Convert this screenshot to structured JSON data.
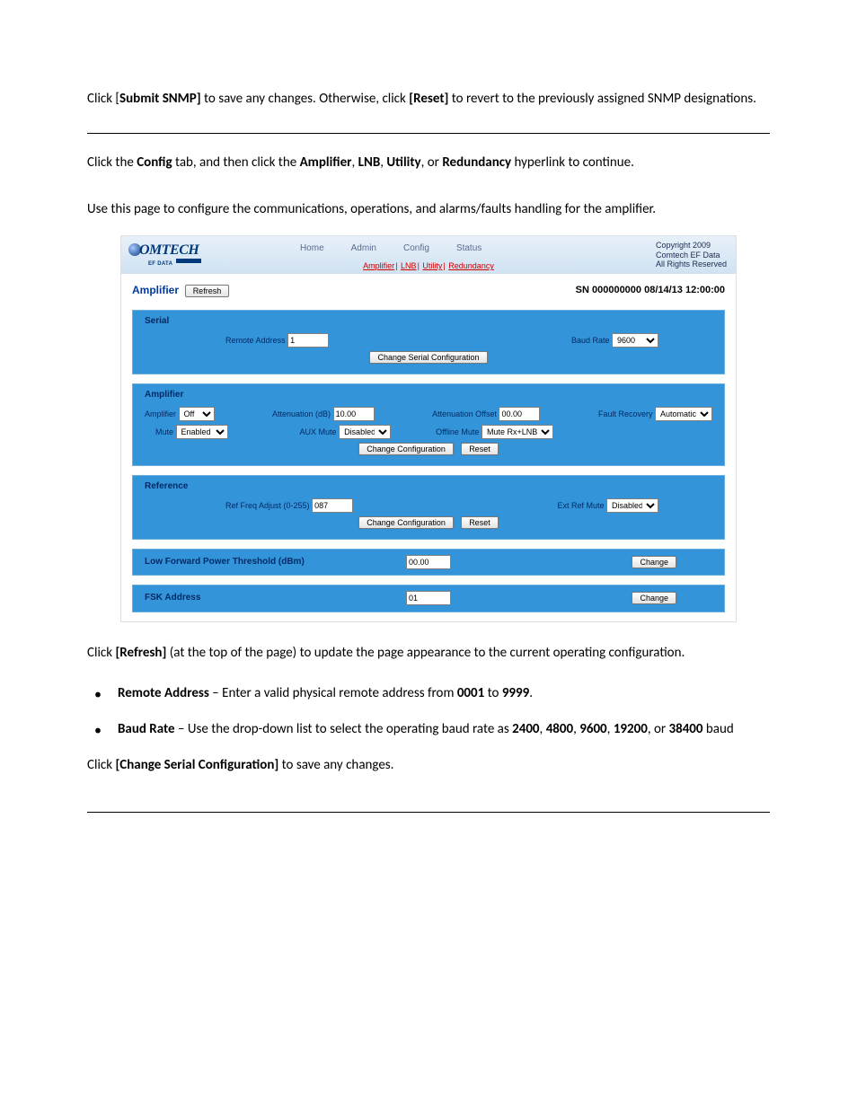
{
  "intro": {
    "p1_a": "Click [",
    "p1_b": "Submit SNMP]",
    "p1_c": " to save any changes. Otherwise, click ",
    "p1_d": "[Reset]",
    "p1_e": " to revert to the previously assigned SNMP designations.",
    "p2_a": "Click the ",
    "p2_b": "Config",
    "p2_c": " tab, and then click the ",
    "p2_d": "Amplifier",
    "p2_e": ", ",
    "p2_f": "LNB",
    "p2_g": ", ",
    "p2_h": "Utility",
    "p2_i": ", or ",
    "p2_j": "Redundancy",
    "p2_k": " hyperlink to continue.",
    "p3": "Use this page to configure the communications, operations, and alarms/faults handling for the amplifier."
  },
  "screenshot": {
    "logo": "OMTECH",
    "logo_sub": "EF DATA ",
    "tabs": {
      "home": "Home",
      "admin": "Admin",
      "config": "Config",
      "status": "Status"
    },
    "subtabs": {
      "amp": "Amplifier",
      "lnb": "LNB",
      "util": "Utility",
      "red": "Redundancy"
    },
    "copyright_l1": "Copyright 2009",
    "copyright_l2": "Comtech EF Data",
    "copyright_l3": "All Rights Reserved",
    "page_title": "Amplifier",
    "refresh": "Refresh",
    "sn_right": "SN 000000000 08/14/13 12:00:00",
    "serial": {
      "title": "Serial",
      "remote_addr_lbl": "Remote Address",
      "remote_addr_val": "1",
      "baud_lbl": "Baud Rate",
      "baud_val": "9600",
      "btn": "Change Serial Configuration"
    },
    "amp": {
      "title": "Amplifier",
      "amp_lbl": "Amplifier",
      "amp_val": "Off",
      "atten_lbl": "Attenuation (dB)",
      "atten_val": "10.00",
      "offset_lbl": "Attenuation Offset",
      "offset_val": "00.00",
      "fault_lbl": "Fault Recovery",
      "fault_val": "Automatic",
      "mute_lbl": "Mute",
      "mute_val": "Enabled",
      "aux_lbl": "AUX Mute",
      "aux_val": "Disabled",
      "off_lbl": "Offline Mute",
      "off_val": "Mute Rx+LNB",
      "btn1": "Change Configuration",
      "btn2": "Reset"
    },
    "ref": {
      "title": "Reference",
      "freq_lbl": "Ref Freq Adjust (0-255)",
      "freq_val": "087",
      "ext_lbl": "Ext Ref Mute",
      "ext_val": "Disabled",
      "btn1": "Change Configuration",
      "btn2": "Reset"
    },
    "lfp": {
      "title": "Low Forward Power Threshold (dBm)",
      "val": "00.00",
      "btn": "Change"
    },
    "fsk": {
      "title": "FSK Address",
      "val": "01",
      "btn": "Change"
    }
  },
  "outro": {
    "p4_a": "Click ",
    "p4_b": "[Refresh]",
    "p4_c": " (at the top of the page) to update the page appearance to the current operating configuration.",
    "li1_a": "Remote Address",
    "li1_b": " – Enter a valid physical remote address from ",
    "li1_c": "0001",
    "li1_d": " to ",
    "li1_e": "9999",
    "li1_f": ".",
    "li2_a": "Baud Rate",
    "li2_b": " – Use the drop-down list to select the operating baud rate as ",
    "li2_c": "2400",
    "li2_d": ", ",
    "li2_e": "4800",
    "li2_f": ", ",
    "li2_g": "9600",
    "li2_h": ", ",
    "li2_i": "19200",
    "li2_j": ", or ",
    "li2_k": "38400",
    "li2_l": " baud",
    "p5_a": "Click ",
    "p5_b": "[Change Serial Configuration]",
    "p5_c": " to save any changes."
  }
}
